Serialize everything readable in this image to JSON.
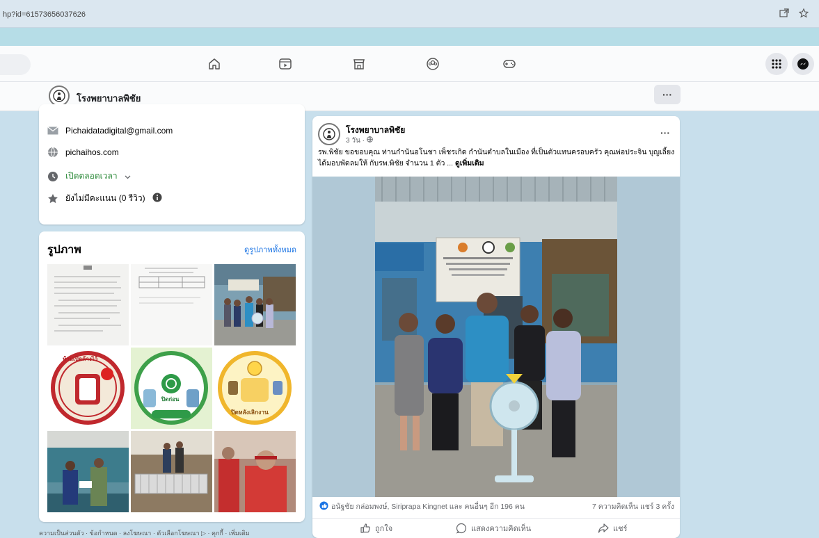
{
  "browser": {
    "url": "hp?id=61573656037626",
    "icons": [
      "open-in-app-icon",
      "star-icon"
    ]
  },
  "topnav": {
    "icons": [
      "home-icon",
      "video-icon",
      "marketplace-icon",
      "groups-icon",
      "gaming-icon"
    ],
    "right_icons": [
      "menu-grid-icon",
      "messenger-icon"
    ]
  },
  "page_header": {
    "name": "โรงพยาบาลพิชัย",
    "more_label": "···"
  },
  "intro": {
    "email": "Pichaidatadigital@gmail.com",
    "website": "pichaihos.com",
    "hours": "เปิดตลอดเวลา",
    "rating": "ยังไม่มีคะแนน (0 รีวิว)"
  },
  "photos": {
    "title": "รูปภาพ",
    "see_all": "ดูรูปภาพทั้งหมด",
    "sticker_texts": [
      "ห้ามเปิดค้างไว้",
      "ปิดก่อน",
      "ปิดหลังเลิกงาน"
    ]
  },
  "footer": {
    "links": "ความเป็นส่วนตัว · ข้อกำหนด · ลงโฆษณา · ตัวเลือกโฆษณา ▷ · คุกกี้ · เพิ่มเติม"
  },
  "post": {
    "author": "โรงพยาบาลพิชัย",
    "time": "3 วัน · ",
    "more": "···",
    "text": "รพ.พิชัย ขอขอบคุณ ท่านกำนันอโนชา เพ็ชรเกิด กำนันตำบลในเมือง ที่เป็นตัวแทนครอบครัว คุณพ่อประจิน บุญเลี้ยง ได้มอบพัดลมให้ กับรพ.พิชัย จำนวน 1 ตัว ... ",
    "see_more": "ดูเพิ่มเติม",
    "reactions": "อนัฐชัย กล่อมพงษ์, Siriprapa Kingnet และ คนอื่นๆ อีก 196 คน",
    "comments_shares": "7 ความคิดเห็น  แชร์ 3 ครั้ง",
    "like": "ถูกใจ",
    "comment": "แสดงความคิดเห็น",
    "share": "แชร์",
    "image_sign": "ศูนย์บริการให้ปรึกษาเรื่องการใช้ยา"
  }
}
